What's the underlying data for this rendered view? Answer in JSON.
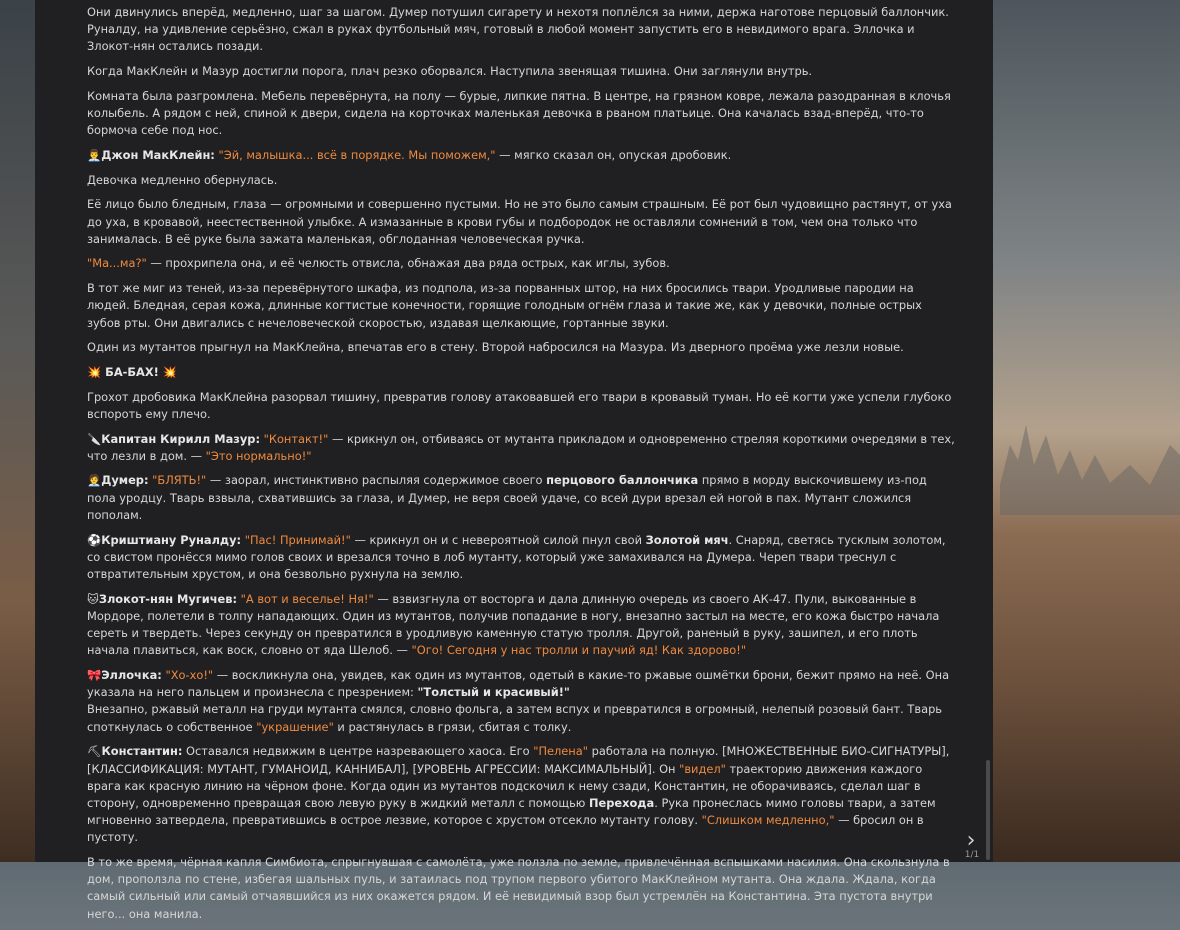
{
  "p1": "Они двинулись вперёд, медленно, шаг за шагом. Думер потушил сигарету и нехотя поплёлся за ними, держа наготове перцовый баллончик. Руналду, на удивление серьёзно, сжал в руках футбольный мяч, готовый в любой момент запустить его в невидимого врага. Эллочка и Злокот-нян остались позади.",
  "p2": "Когда МакКлейн и Мазур достигли порога, плач резко оборвался. Наступила звенящая тишина. Они заглянули внутрь.",
  "p3": "Комната была разгромлена. Мебель перевёрнута, на полу — бурые, липкие пятна. В центре, на грязном ковре, лежала разодранная в клочья колыбель. А рядом с ней, спиной к двери, сидела на корточках маленькая девочка в рваном платьице. Она качалась взад-вперёд, что-то бормоча себе под нос.",
  "p4": {
    "icon": "👨‍💼",
    "name": "Джон МакКлейн:",
    "quote": "\"Эй, малышка... всё в порядке. Мы поможем,\"",
    "rest": " — мягко сказал он, опуская дробовик."
  },
  "p5": "Девочка медленно обернулась.",
  "p6": "Её лицо было бледным, глаза — огромными и совершенно пустыми. Но не это было самым страшным. Её рот был чудовищно растянут, от уха до уха, в кровавой, неестественной улыбке. А измазанные в крови губы и подбородок не оставляли сомнений в том, чем она только что занималась. В её руке была зажата маленькая, обглоданная человеческая ручка.",
  "p7": {
    "quote": "\"Ма...ма?\"",
    "rest": " — прохрипела она, и её челюсть отвисла, обнажая два ряда острых, как иглы, зубов."
  },
  "p8": "В тот же миг из теней, из-за перевёрнутого шкафа, из подпола, из-за порванных штор, на них бросились твари. Уродливые пародии на людей. Бледная, серая кожа, длинные когтистые конечности, горящие голодным огнём глаза и такие же, как у девочки, полные острых зубов рты. Они двигались с нечеловеческой скоростью, издавая щелкающие, гортанные звуки.",
  "p9": "Один из мутантов прыгнул на МакКлейна, впечатав его в стену. Второй набросился на Мазура. Из дверного проёма уже лезли новые.",
  "p10": {
    "icon1": "💥",
    "text": " БА-БАХ! ",
    "icon2": "💥"
  },
  "p11": "Грохот дробовика МакКлейна разорвал тишину, превратив голову атаковавшей его твари в кровавый туман. Но её когти уже успели глубоко вспороть ему плечо.",
  "p12": {
    "icon": "🔪",
    "name": "Капитан Кирилл Мазур:",
    "quote1": "\"Контакт!\"",
    "mid": " — крикнул он, отбиваясь от мутанта прикладом и одновременно стреляя короткими очередями в тех, что лезли в дом. — ",
    "quote2": "\"Это нормально!\""
  },
  "p13": {
    "icon": "🧑‍💼",
    "name": "Думер:",
    "quote": "\"БЛЯТЬ!\"",
    "mid": " — заорал, инстинктивно распыляя содержимое своего ",
    "bold": "перцового баллончика",
    "rest": " прямо в морду выскочившему из-под пола уродцу. Тварь взвыла, схватившись за глаза, и Думер, не веря своей удаче, со всей дури врезал ей ногой в пах. Мутант сложился пополам."
  },
  "p14": {
    "icon": "⚽",
    "name": "Криштиану Руналду:",
    "quote": "\"Пас! Принимай!\"",
    "mid": " — крикнул он и с невероятной силой пнул свой ",
    "bold": "Золотой мяч",
    "rest": ". Снаряд, светясь тусклым золотом, со свистом пронёсся мимо голов своих и врезался точно в лоб мутанту, который уже замахивался на Думера. Череп твари треснул с отвратительным хрустом, и она безвольно рухнула на землю."
  },
  "p15": {
    "icon": "🐱",
    "name": "Злокот-нян Мугичев:",
    "quote1": "\"А вот и веселье! Ня!\"",
    "mid": " — взвизгнула от восторга и дала длинную очередь из своего АК-47. Пули, выкованные в Мордоре, полетели в толпу нападающих. Один из мутантов, получив попадание в ногу, внезапно застыл на месте, его кожа быстро начала сереть и твердеть. Через секунду он превратился в уродливую каменную статую тролля. Другой, раненый в руку, зашипел, и его плоть начала плавиться, как воск, словно от яда Шелоб. — ",
    "quote2": "\"Ого! Сегодня у нас тролли и паучий яд! Как здорово!\""
  },
  "p16": {
    "icon": "🎀",
    "name": "Эллочка:",
    "quote1": "\"Хо-хо!\"",
    "mid": " — воскликнула она, увидев, как один из мутантов, одетый в какие-то ржавые ошмётки брони, бежит прямо на неё. Она указала на него пальцем и произнесла с презрением: ",
    "quote2": "\"Толстый и красивый!\"",
    "line2a": "Внезапно, ржавый металл на груди мутанта смялся, словно фольга, а затем вспух и превратился в огромный, нелепый розовый бант. Тварь споткнулась о собственное ",
    "quote3": "\"украшение\"",
    "line2b": " и растянулась в грязи, сбитая с толку."
  },
  "p17": {
    "icon": "⛏",
    "name": "Константин:",
    "a": " Оставался недвижим в центре назревающего хаоса. Его ",
    "q1": "\"Пелена\"",
    "b": " работала на полную. [МНОЖЕСТВЕННЫЕ БИО-СИГНАТУРЫ], [КЛАССИФИКАЦИЯ: МУТАНТ, ГУМАНОИД, КАННИБАЛ], [УРОВЕНЬ АГРЕССИИ: МАКСИМАЛЬНЫЙ]. Он ",
    "q2": "\"видел\"",
    "c": " траекторию движения каждого врага как красную линию на чёрном фоне. Когда один из мутантов подскочил к нему сзади, Константин, не оборачиваясь, сделал шаг в сторону, одновременно превращая свою левую руку в жидкий металл с помощью ",
    "bold": "Перехода",
    "d": ". Рука пронеслась мимо головы твари, а затем мгновенно затвердела, превратившись в острое лезвие, которое с хрустом отсекло мутанту голову. ",
    "q3": "\"Слишком медленно,\"",
    "e": " — бросил он в пустоту."
  },
  "p18": "В то же время, чёрная капля Симбиота, спрыгнувшая с самолёта, уже ползла по земле, привлечённая вспышками насилия. Она скользнула в дом, проползла по стене, избегая шальных пуль, и затаилась под трупом первого убитого МакКлейном мутанта. Она ждала. Ждала, когда самый сильный или самый отчаявшийся из них окажется рядом. И её невидимый взор был устремлён на Константина. Эта пустота внутри него... она манила.",
  "nav": {
    "next_glyph": "›",
    "page": "1/1"
  }
}
